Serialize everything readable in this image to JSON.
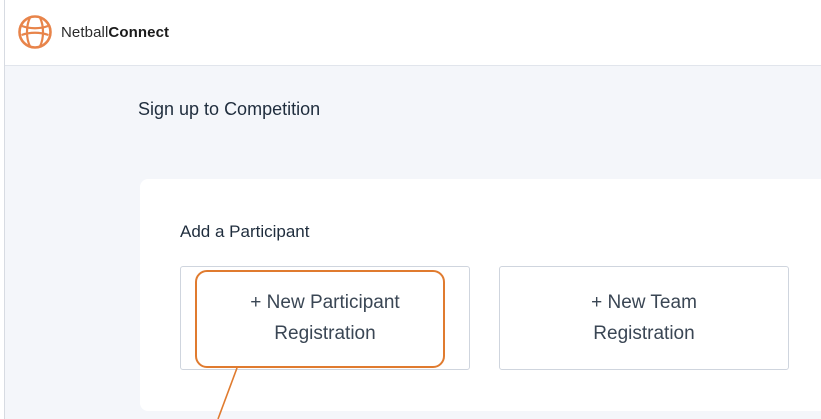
{
  "header": {
    "brand_regular": "Netball",
    "brand_bold": "Connect",
    "logo_icon": "netball-icon"
  },
  "page": {
    "title": "Sign up to Competition"
  },
  "participant_section": {
    "title": "Add a Participant",
    "options": [
      {
        "label": "+ New Participant\nRegistration"
      },
      {
        "label": "+ New Team\nRegistration"
      }
    ]
  },
  "colors": {
    "accent_highlight": "#e07b2f",
    "logo": "#e8844a",
    "page_background": "#f4f6fa"
  }
}
